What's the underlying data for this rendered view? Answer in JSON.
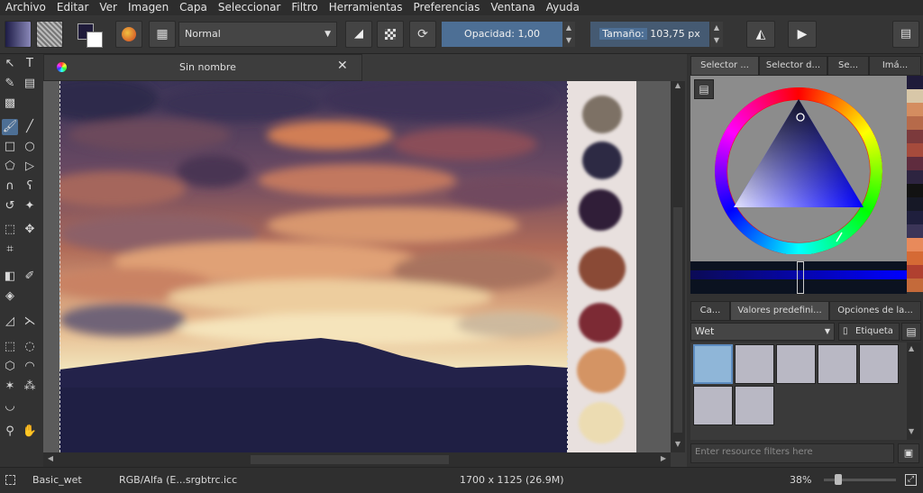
{
  "menu": [
    "Archivo",
    "Editar",
    "Ver",
    "Imagen",
    "Capa",
    "Seleccionar",
    "Filtro",
    "Herramientas",
    "Preferencias",
    "Ventana",
    "Ayuda"
  ],
  "toolbar": {
    "blend_mode": "Normal",
    "opacity_label": "Opacidad:",
    "opacity_value": "1,00",
    "size_label": "Tamaño:",
    "size_value": "103,75 px"
  },
  "document": {
    "tab_title": "Sin nombre"
  },
  "docker": {
    "top_tabs": [
      "Selector ...",
      "Selector d...",
      "Se...",
      "Imá..."
    ],
    "bottom_tabs": [
      "Ca...",
      "Valores predefini...",
      "Opciones de la..."
    ],
    "preset_filter": "Wet",
    "tag_label": "Etiqueta",
    "resource_filter_placeholder": "Enter resource filters here"
  },
  "palette_colors": [
    "#1f1b3a",
    "#d8c7a8",
    "#d48d60",
    "#b66a4a",
    "#7c3a3c",
    "#a64b3c",
    "#5f2c3e",
    "#2d2440",
    "#121212",
    "#161826",
    "#1f1f3d",
    "#3b3558",
    "#e88a5b",
    "#d56a35",
    "#b04030",
    "#c46a3a"
  ],
  "swatches": [
    "#7d7165",
    "#2d2a44",
    "#301e38",
    "#8a4a36",
    "#7c2a34",
    "#d49464",
    "#ecdcb2"
  ],
  "status": {
    "brush_name": "Basic_wet",
    "color_profile": "RGB/Alfa (E...srgbtrc.icc",
    "image_size": "1700 x 1125 (26.9M)",
    "zoom": "38%"
  }
}
